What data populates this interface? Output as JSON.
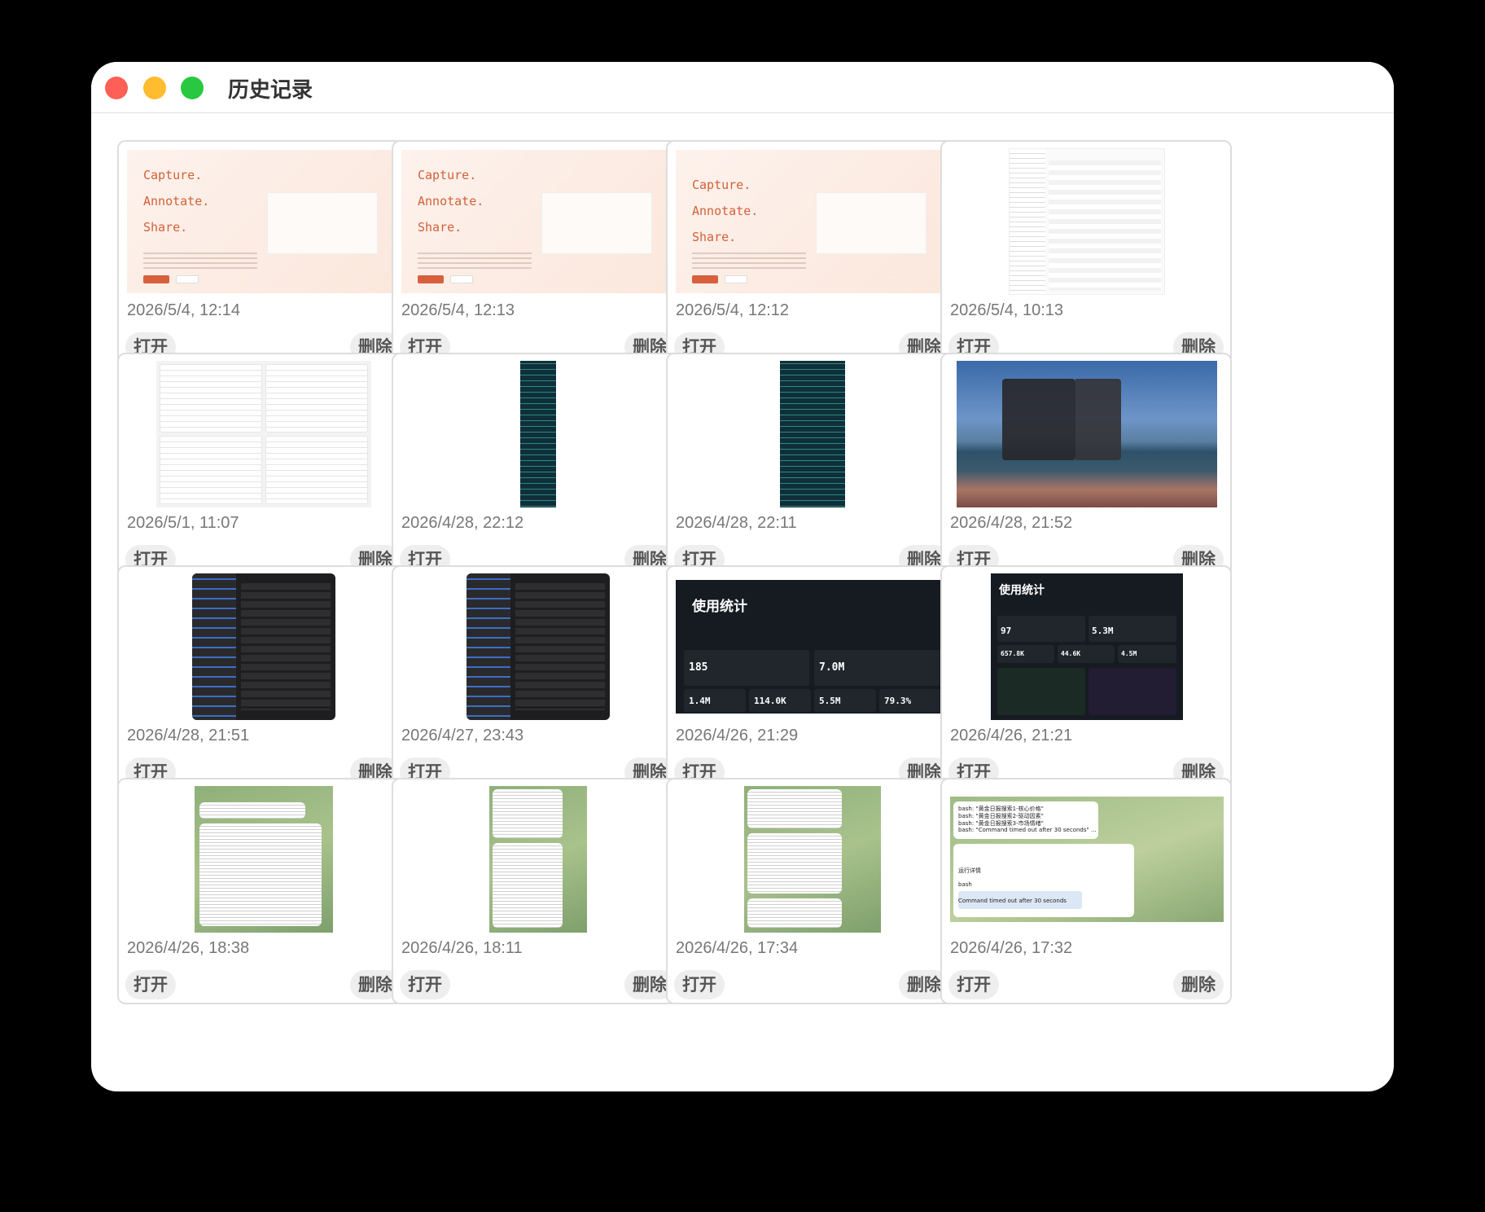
{
  "window": {
    "title": "历史记录"
  },
  "buttons": {
    "open": "打开",
    "delete": "删除"
  },
  "thumb_text": {
    "landing_lines": [
      "Capture.",
      "Annotate.",
      "Share."
    ],
    "dash_title": "使用统计",
    "dash_values": [
      "185",
      "7.0M",
      "1.4M",
      "114.0K",
      "5.5M",
      "79.3%"
    ],
    "dash2_values": [
      "97",
      "5.3M",
      "657.8K",
      "44.6K",
      "4.5M"
    ],
    "chat_lines": [
      "bash: \"黄金日报搜索1-核心价格\"",
      "bash: \"黄金日报搜索2-驱动因素\"",
      "bash: \"黄金日报搜索3-市场情绪\"",
      "bash: \"Command timed out after 30 seconds\" ...",
      "运行详情",
      "bash",
      "Command timed out after 30 seconds"
    ]
  },
  "items": [
    {
      "timestamp": "2026/5/4, 12:14",
      "thumb": "landing"
    },
    {
      "timestamp": "2026/5/4, 12:13",
      "thumb": "landing"
    },
    {
      "timestamp": "2026/5/4, 12:12",
      "thumb": "landing-nav"
    },
    {
      "timestamp": "2026/5/4, 10:13",
      "thumb": "finder"
    },
    {
      "timestamp": "2026/5/1, 11:07",
      "thumb": "agents"
    },
    {
      "timestamp": "2026/4/28, 22:12",
      "thumb": "code-narrow"
    },
    {
      "timestamp": "2026/4/28, 22:11",
      "thumb": "code-wide"
    },
    {
      "timestamp": "2026/4/28, 21:52",
      "thumb": "landscape"
    },
    {
      "timestamp": "2026/4/28, 21:51",
      "thumb": "settings"
    },
    {
      "timestamp": "2026/4/27, 23:43",
      "thumb": "settings"
    },
    {
      "timestamp": "2026/4/26, 21:29",
      "thumb": "dashboard"
    },
    {
      "timestamp": "2026/4/26, 21:21",
      "thumb": "dashboard-tall"
    },
    {
      "timestamp": "2026/4/26, 18:38",
      "thumb": "chat"
    },
    {
      "timestamp": "2026/4/26, 18:11",
      "thumb": "chat-narrow"
    },
    {
      "timestamp": "2026/4/26, 17:34",
      "thumb": "chat-mid"
    },
    {
      "timestamp": "2026/4/26, 17:32",
      "thumb": "chat-wide"
    }
  ],
  "colors": {
    "accent": "#d9603c",
    "red": "#fe5f57",
    "yellow": "#febc2e",
    "green": "#28c840"
  }
}
